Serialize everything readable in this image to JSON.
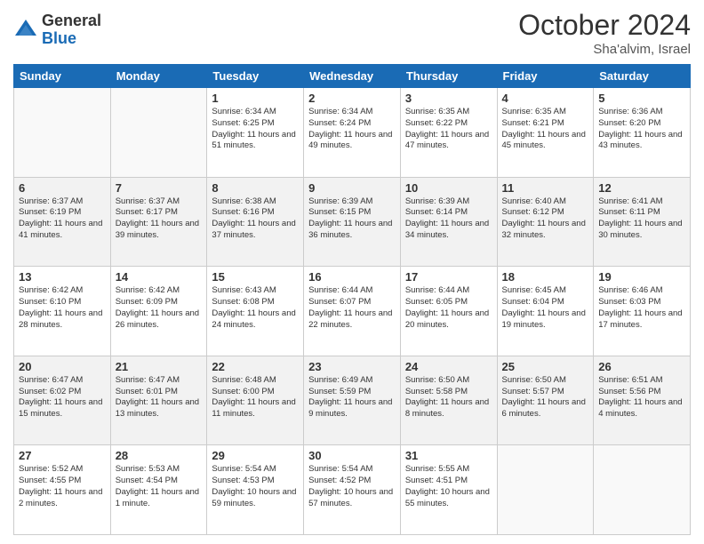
{
  "logo": {
    "general": "General",
    "blue": "Blue"
  },
  "title": "October 2024",
  "location": "Sha'alvim, Israel",
  "days_of_week": [
    "Sunday",
    "Monday",
    "Tuesday",
    "Wednesday",
    "Thursday",
    "Friday",
    "Saturday"
  ],
  "weeks": [
    [
      {
        "day": "",
        "info": ""
      },
      {
        "day": "",
        "info": ""
      },
      {
        "day": "1",
        "info": "Sunrise: 6:34 AM\nSunset: 6:25 PM\nDaylight: 11 hours and 51 minutes."
      },
      {
        "day": "2",
        "info": "Sunrise: 6:34 AM\nSunset: 6:24 PM\nDaylight: 11 hours and 49 minutes."
      },
      {
        "day": "3",
        "info": "Sunrise: 6:35 AM\nSunset: 6:22 PM\nDaylight: 11 hours and 47 minutes."
      },
      {
        "day": "4",
        "info": "Sunrise: 6:35 AM\nSunset: 6:21 PM\nDaylight: 11 hours and 45 minutes."
      },
      {
        "day": "5",
        "info": "Sunrise: 6:36 AM\nSunset: 6:20 PM\nDaylight: 11 hours and 43 minutes."
      }
    ],
    [
      {
        "day": "6",
        "info": "Sunrise: 6:37 AM\nSunset: 6:19 PM\nDaylight: 11 hours and 41 minutes."
      },
      {
        "day": "7",
        "info": "Sunrise: 6:37 AM\nSunset: 6:17 PM\nDaylight: 11 hours and 39 minutes."
      },
      {
        "day": "8",
        "info": "Sunrise: 6:38 AM\nSunset: 6:16 PM\nDaylight: 11 hours and 37 minutes."
      },
      {
        "day": "9",
        "info": "Sunrise: 6:39 AM\nSunset: 6:15 PM\nDaylight: 11 hours and 36 minutes."
      },
      {
        "day": "10",
        "info": "Sunrise: 6:39 AM\nSunset: 6:14 PM\nDaylight: 11 hours and 34 minutes."
      },
      {
        "day": "11",
        "info": "Sunrise: 6:40 AM\nSunset: 6:12 PM\nDaylight: 11 hours and 32 minutes."
      },
      {
        "day": "12",
        "info": "Sunrise: 6:41 AM\nSunset: 6:11 PM\nDaylight: 11 hours and 30 minutes."
      }
    ],
    [
      {
        "day": "13",
        "info": "Sunrise: 6:42 AM\nSunset: 6:10 PM\nDaylight: 11 hours and 28 minutes."
      },
      {
        "day": "14",
        "info": "Sunrise: 6:42 AM\nSunset: 6:09 PM\nDaylight: 11 hours and 26 minutes."
      },
      {
        "day": "15",
        "info": "Sunrise: 6:43 AM\nSunset: 6:08 PM\nDaylight: 11 hours and 24 minutes."
      },
      {
        "day": "16",
        "info": "Sunrise: 6:44 AM\nSunset: 6:07 PM\nDaylight: 11 hours and 22 minutes."
      },
      {
        "day": "17",
        "info": "Sunrise: 6:44 AM\nSunset: 6:05 PM\nDaylight: 11 hours and 20 minutes."
      },
      {
        "day": "18",
        "info": "Sunrise: 6:45 AM\nSunset: 6:04 PM\nDaylight: 11 hours and 19 minutes."
      },
      {
        "day": "19",
        "info": "Sunrise: 6:46 AM\nSunset: 6:03 PM\nDaylight: 11 hours and 17 minutes."
      }
    ],
    [
      {
        "day": "20",
        "info": "Sunrise: 6:47 AM\nSunset: 6:02 PM\nDaylight: 11 hours and 15 minutes."
      },
      {
        "day": "21",
        "info": "Sunrise: 6:47 AM\nSunset: 6:01 PM\nDaylight: 11 hours and 13 minutes."
      },
      {
        "day": "22",
        "info": "Sunrise: 6:48 AM\nSunset: 6:00 PM\nDaylight: 11 hours and 11 minutes."
      },
      {
        "day": "23",
        "info": "Sunrise: 6:49 AM\nSunset: 5:59 PM\nDaylight: 11 hours and 9 minutes."
      },
      {
        "day": "24",
        "info": "Sunrise: 6:50 AM\nSunset: 5:58 PM\nDaylight: 11 hours and 8 minutes."
      },
      {
        "day": "25",
        "info": "Sunrise: 6:50 AM\nSunset: 5:57 PM\nDaylight: 11 hours and 6 minutes."
      },
      {
        "day": "26",
        "info": "Sunrise: 6:51 AM\nSunset: 5:56 PM\nDaylight: 11 hours and 4 minutes."
      }
    ],
    [
      {
        "day": "27",
        "info": "Sunrise: 5:52 AM\nSunset: 4:55 PM\nDaylight: 11 hours and 2 minutes."
      },
      {
        "day": "28",
        "info": "Sunrise: 5:53 AM\nSunset: 4:54 PM\nDaylight: 11 hours and 1 minute."
      },
      {
        "day": "29",
        "info": "Sunrise: 5:54 AM\nSunset: 4:53 PM\nDaylight: 10 hours and 59 minutes."
      },
      {
        "day": "30",
        "info": "Sunrise: 5:54 AM\nSunset: 4:52 PM\nDaylight: 10 hours and 57 minutes."
      },
      {
        "day": "31",
        "info": "Sunrise: 5:55 AM\nSunset: 4:51 PM\nDaylight: 10 hours and 55 minutes."
      },
      {
        "day": "",
        "info": ""
      },
      {
        "day": "",
        "info": ""
      }
    ]
  ]
}
